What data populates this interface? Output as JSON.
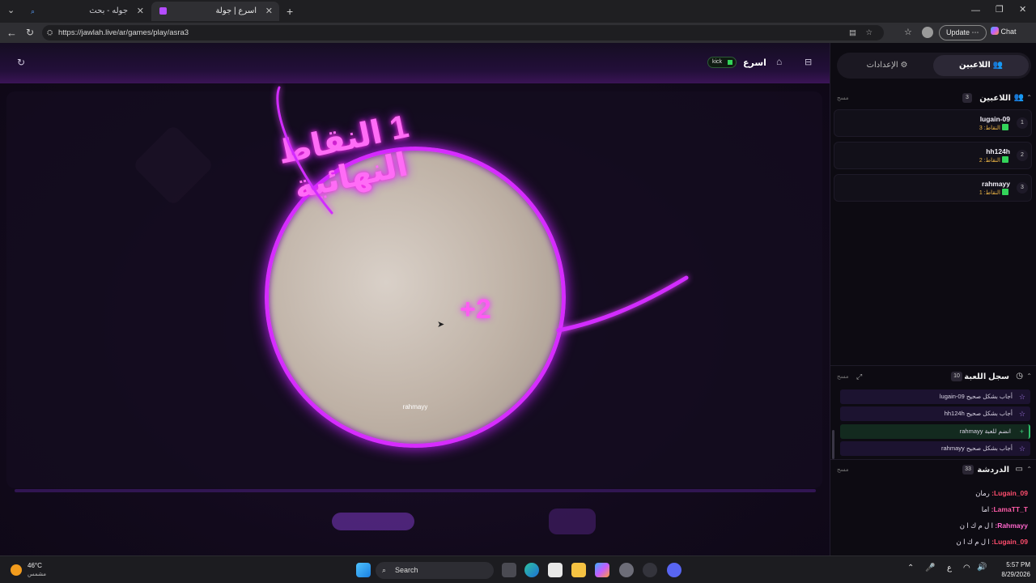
{
  "tabs": [
    {
      "title": "جوله - بحث",
      "active": false
    },
    {
      "title": "اسرع | جولة",
      "active": true
    }
  ],
  "address": {
    "url": "https://jawlah.live/ar/games/play/asra3"
  },
  "toolbar": {
    "update_label": "Update",
    "chat_label": "Chat"
  },
  "game": {
    "title": "اسرع",
    "platform_badge": "kick",
    "overlay_text": "1 النقاط النهائية",
    "plus_text": "+2",
    "wheel_player": "rahmayy"
  },
  "sidebar": {
    "tabs": {
      "players": "اللاعبين",
      "settings": "الإعدادات"
    },
    "players_section": {
      "title": "اللاعبين",
      "count": "3",
      "clear": "مسح"
    },
    "players": [
      {
        "rank": "1",
        "name": "lugain-09",
        "points_label": "النقاط: 3",
        "platform": "Kick"
      },
      {
        "rank": "2",
        "name": "hh124h",
        "points_label": "النقاط: 2",
        "platform": "Kick"
      },
      {
        "rank": "3",
        "name": "rahmayy",
        "points_label": "النقاط: 1",
        "platform": "Kick"
      }
    ],
    "log_section": {
      "title": "سجل اللعبة",
      "count": "10",
      "clear": "مسح"
    },
    "log": [
      {
        "text": "lugain-09 أجاب بشكل صحيح",
        "kind": "correct"
      },
      {
        "text": "hh124h أجاب بشكل صحيح",
        "kind": "correct"
      },
      {
        "text": "rahmayy انضم للعبة",
        "kind": "join"
      },
      {
        "text": "rahmayy أجاب بشكل صحيح",
        "kind": "correct"
      }
    ],
    "chat_section": {
      "title": "الدردشة",
      "count": "33",
      "clear": "مسح"
    },
    "chat": [
      {
        "user": "Lugain_09:",
        "msg": "رمان",
        "color": "#ff4d6d"
      },
      {
        "user": "LamaTT_T:",
        "msg": "اما",
        "color": "#ff5ca8"
      },
      {
        "user": "Rahmayy:",
        "msg": "ا ل م ك ا ن",
        "color": "#ff66cc"
      },
      {
        "user": "Lugain_09:",
        "msg": "ا ل م ك ا ن",
        "color": "#ff4d6d"
      }
    ]
  },
  "taskbar": {
    "weather_temp": "46°C",
    "weather_desc": "مشمس",
    "search_label": "Search",
    "time": "5:57 PM",
    "date": "8/29/2026",
    "lang": "ع"
  }
}
